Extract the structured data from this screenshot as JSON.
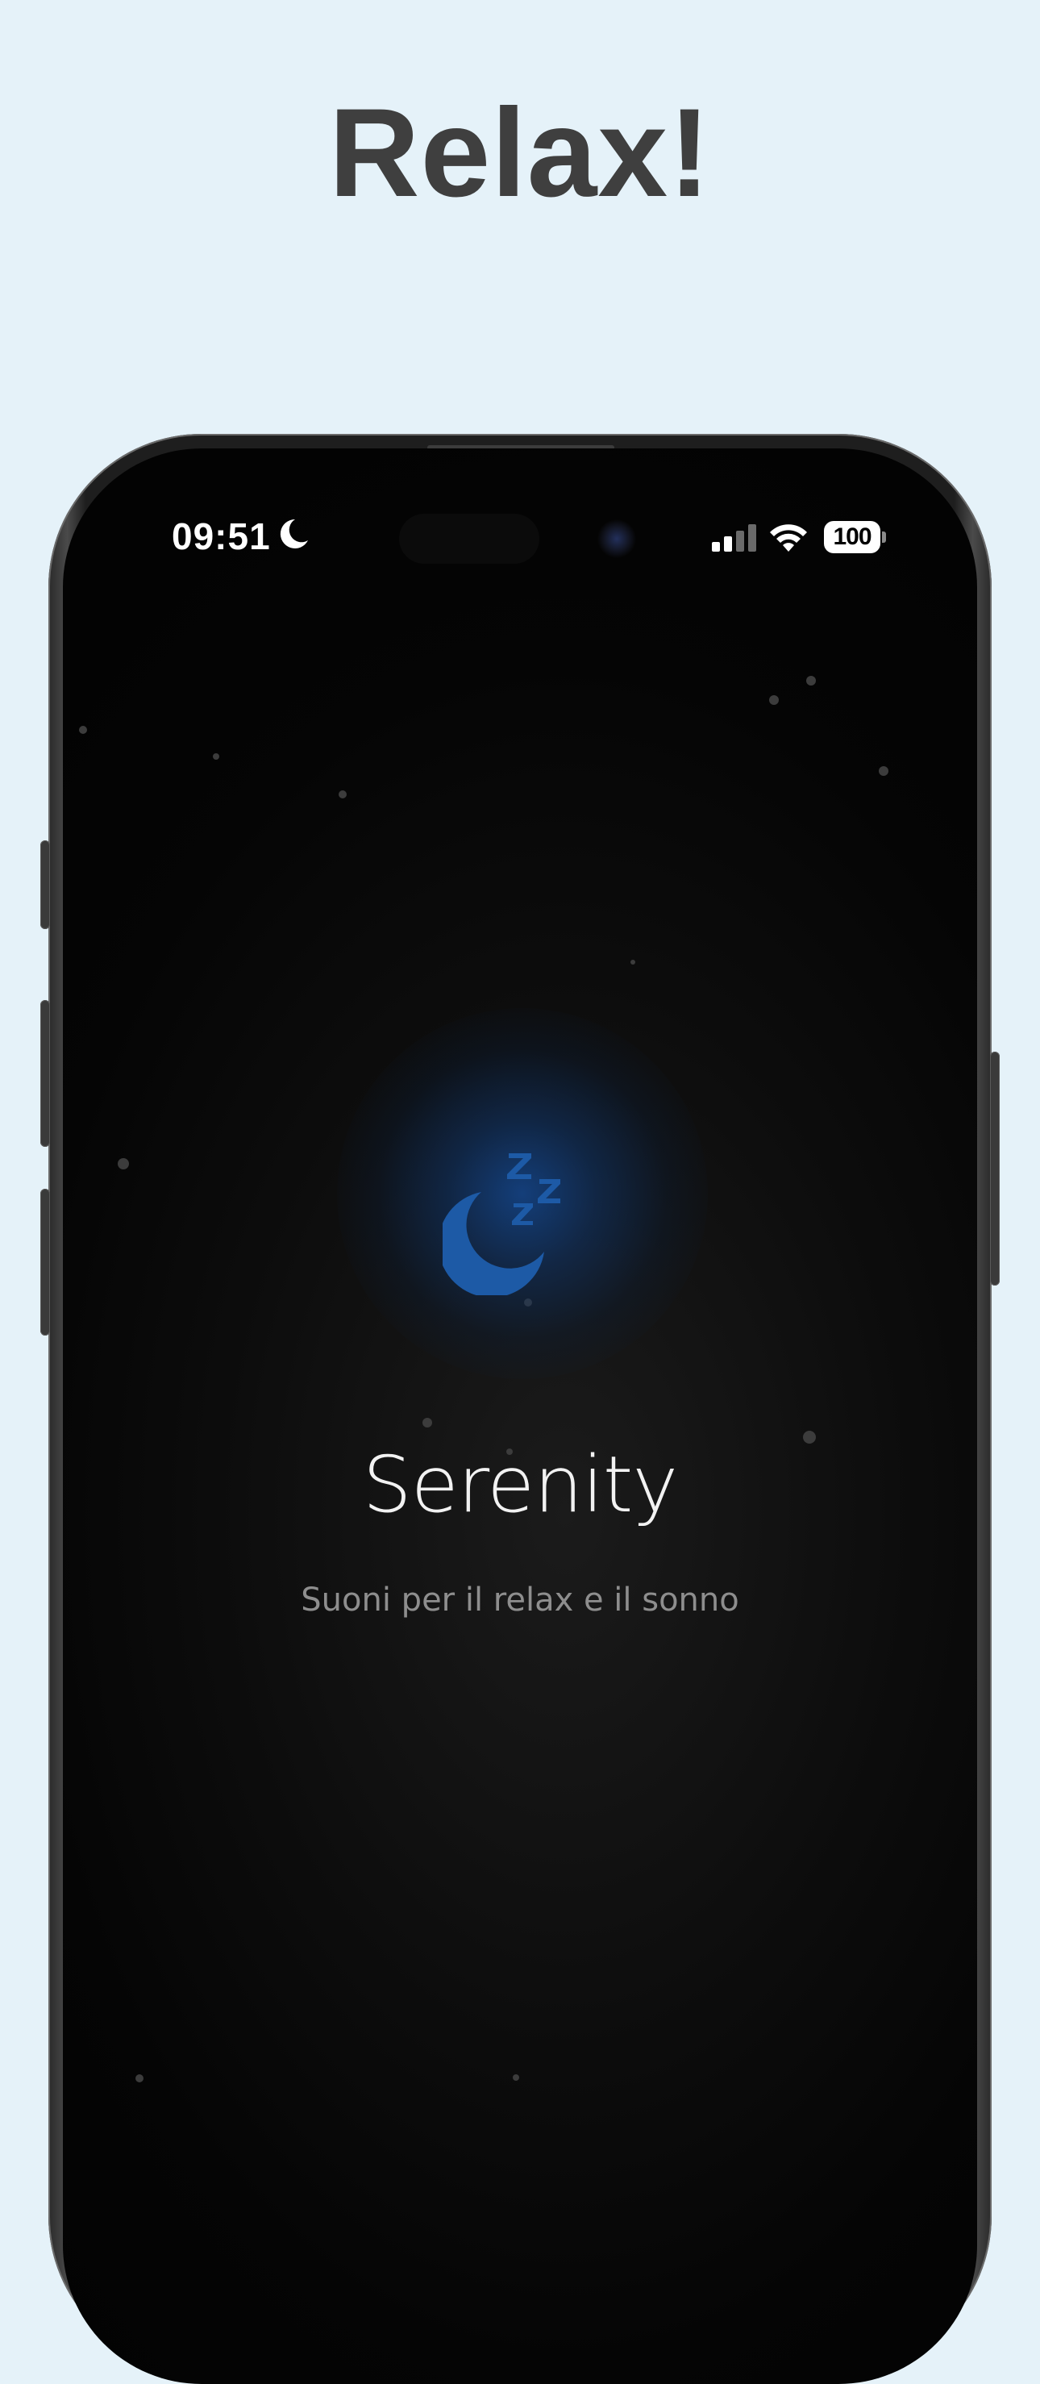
{
  "headline": "Relax!",
  "status_bar": {
    "time": "09:51",
    "focus_icon": "moon-icon",
    "signal_icon": "cellular-signal-icon",
    "wifi_icon": "wifi-icon",
    "battery_level": "100"
  },
  "app": {
    "icon": "sleep-moon-zzz-icon",
    "title": "Serenity",
    "subtitle": "Suoni per il relax e il sonno"
  },
  "colors": {
    "page_background": "#e5f2f9",
    "headline": "#3f3f3f",
    "screen_background": "#0a0a0a",
    "accent_blue": "#1d5aa6",
    "title": "#f2f2f2",
    "subtitle": "#8e8e8e"
  }
}
